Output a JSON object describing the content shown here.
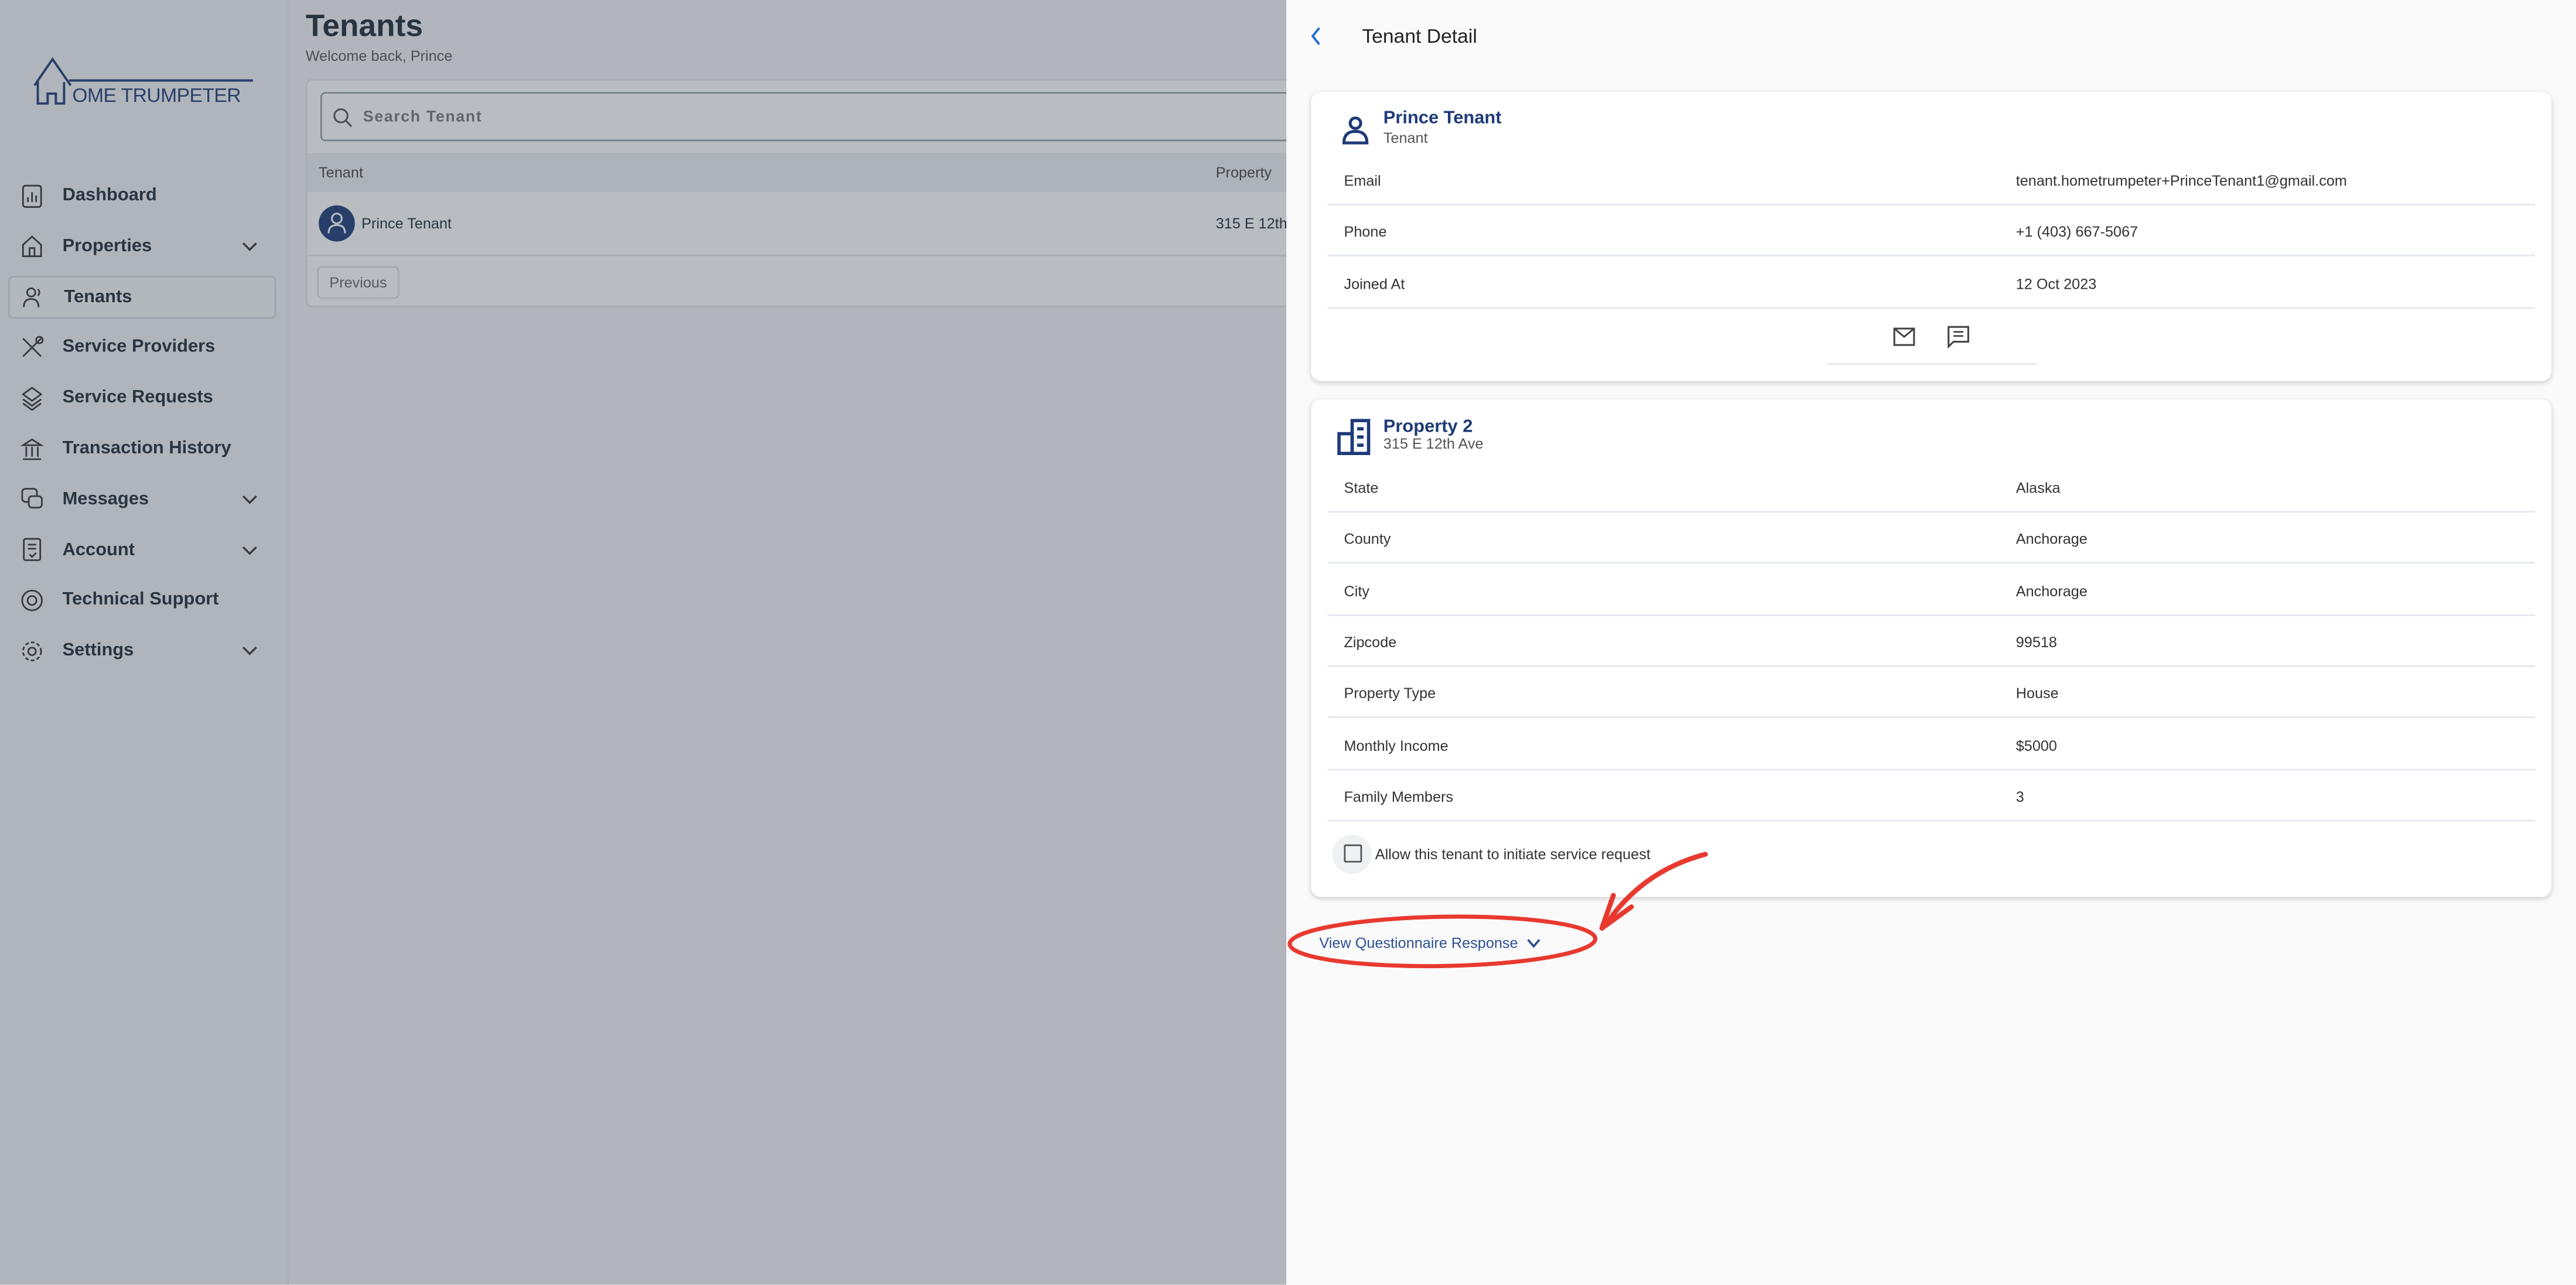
{
  "brand": {
    "logo_text": "OME TRUMPETER",
    "color": "#1e3a78"
  },
  "sidebar": {
    "items": [
      {
        "label": "Dashboard",
        "icon": "chart-icon",
        "chevron": false
      },
      {
        "label": "Properties",
        "icon": "home-icon",
        "chevron": true
      },
      {
        "label": "Tenants",
        "icon": "users-icon",
        "chevron": false,
        "selected": true
      },
      {
        "label": "Service Providers",
        "icon": "tools-icon",
        "chevron": false
      },
      {
        "label": "Service Requests",
        "icon": "layers-icon",
        "chevron": false
      },
      {
        "label": "Transaction History",
        "icon": "bank-icon",
        "chevron": false
      },
      {
        "label": "Messages",
        "icon": "chat-icon",
        "chevron": true
      },
      {
        "label": "Account",
        "icon": "document-icon",
        "chevron": true
      },
      {
        "label": "Technical Support",
        "icon": "lifebuoy-icon",
        "chevron": false
      },
      {
        "label": "Settings",
        "icon": "gear-icon",
        "chevron": true
      }
    ]
  },
  "main": {
    "title": "Tenants",
    "subtitle": "Welcome back, Prince",
    "search_placeholder": "Search Tenant",
    "columns": [
      "Tenant",
      "Property"
    ],
    "rows": [
      {
        "tenant": "Prince Tenant",
        "property": "315 E 12th"
      }
    ],
    "previous_label": "Previous"
  },
  "drawer": {
    "title": "Tenant Detail",
    "tenant": {
      "name": "Prince Tenant",
      "role": "Tenant",
      "fields": [
        {
          "label": "Email",
          "value": "tenant.hometrumpeter+PrinceTenant1@gmail.com"
        },
        {
          "label": "Phone",
          "value": "+1 (403) 667-5067"
        },
        {
          "label": "Joined At",
          "value": "12 Oct 2023"
        }
      ]
    },
    "property": {
      "name": "Property 2",
      "address": "315 E 12th Ave",
      "fields": [
        {
          "label": "State",
          "value": "Alaska"
        },
        {
          "label": "County",
          "value": "Anchorage"
        },
        {
          "label": "City",
          "value": "Anchorage"
        },
        {
          "label": "Zipcode",
          "value": "99518"
        },
        {
          "label": "Property Type",
          "value": "House"
        },
        {
          "label": "Monthly Income",
          "value": "$5000"
        },
        {
          "label": "Family Members",
          "value": "3"
        }
      ],
      "allow_service_request_label": "Allow this tenant to initiate service request",
      "allow_service_request_checked": false
    },
    "questionnaire_link": "View Questionnaire Response"
  },
  "annotation_color": "#e8392f"
}
